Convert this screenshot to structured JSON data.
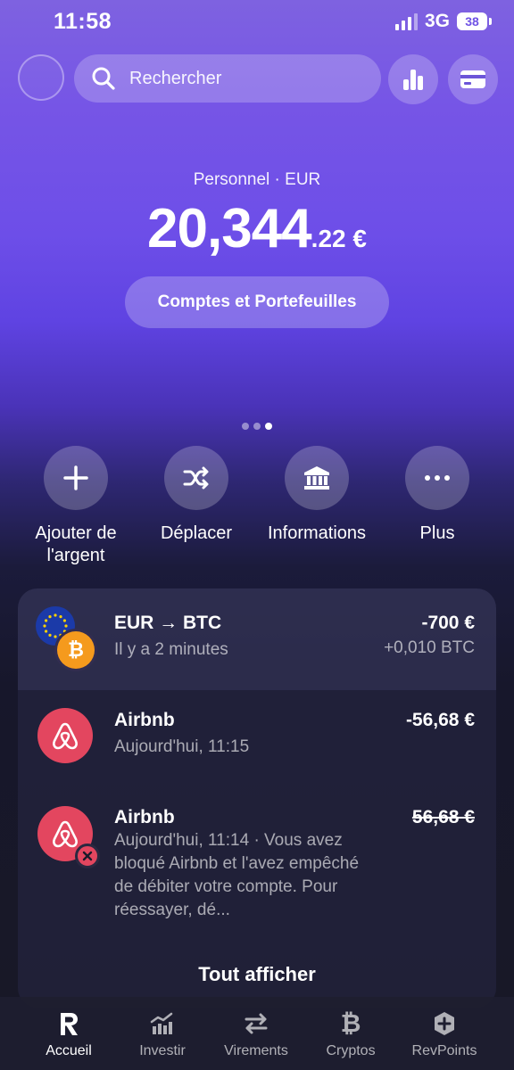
{
  "status": {
    "time": "11:58",
    "network": "3G",
    "battery": "38"
  },
  "search": {
    "placeholder": "Rechercher"
  },
  "balance": {
    "account_label": "Personnel · EUR",
    "main": "20,344",
    "cents": ".22 €",
    "accounts_button": "Comptes et Portefeuilles"
  },
  "actions": [
    {
      "label": "Ajouter de l'argent",
      "icon": "plus-icon"
    },
    {
      "label": "Déplacer",
      "icon": "shuffle-icon"
    },
    {
      "label": "Informations",
      "icon": "bank-icon"
    },
    {
      "label": "Plus",
      "icon": "more-icon"
    }
  ],
  "transactions": [
    {
      "title": "EUR → BTC",
      "subtitle": "Il y a 2 minutes",
      "amount": "-700 €",
      "secondary": "+0,010 BTC"
    },
    {
      "title": "Airbnb",
      "subtitle": "Aujourd'hui, 11:15",
      "amount": "-56,68 €"
    },
    {
      "title": "Airbnb",
      "subtitle": "Aujourd'hui, 11:14 · Vous avez bloqué Airbnb et l'avez empêché de débiter votre compte. Pour réessayer, dé...",
      "amount": "56,68 €",
      "declined": true
    }
  ],
  "show_all": "Tout afficher",
  "nav": [
    {
      "label": "Accueil",
      "icon": "revolut-logo-icon",
      "active": true
    },
    {
      "label": "Investir",
      "icon": "chart-icon"
    },
    {
      "label": "Virements",
      "icon": "transfer-arrows-icon"
    },
    {
      "label": "Cryptos",
      "icon": "bitcoin-icon"
    },
    {
      "label": "RevPoints",
      "icon": "revpoints-icon"
    }
  ],
  "colors": {
    "accent": "#6d4ee8",
    "airbnb": "#e3465f",
    "bitcoin": "#f59a1d"
  }
}
